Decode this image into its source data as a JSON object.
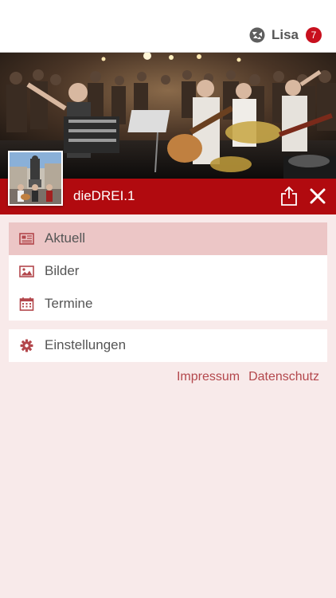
{
  "header": {
    "user_name": "Lisa",
    "notification_count": "7",
    "user_icon": "drei-logo-icon"
  },
  "group": {
    "name": "dieDREI.1",
    "share_icon": "share-icon",
    "close_icon": "close-icon"
  },
  "menu": {
    "items": [
      {
        "label": "Aktuell",
        "icon": "news-icon",
        "active": true
      },
      {
        "label": "Bilder",
        "icon": "image-icon",
        "active": false
      },
      {
        "label": "Termine",
        "icon": "calendar-icon",
        "active": false
      }
    ],
    "settings": {
      "label": "Einstellungen",
      "icon": "gear-icon"
    }
  },
  "footer_links": {
    "impressum": "Impressum",
    "datenschutz": "Datenschutz"
  },
  "colors": {
    "accent": "#b10a0f",
    "badge": "#c8101e",
    "background": "#f8eaea",
    "active_item": "#ecc6c6",
    "link": "#b3474c"
  }
}
